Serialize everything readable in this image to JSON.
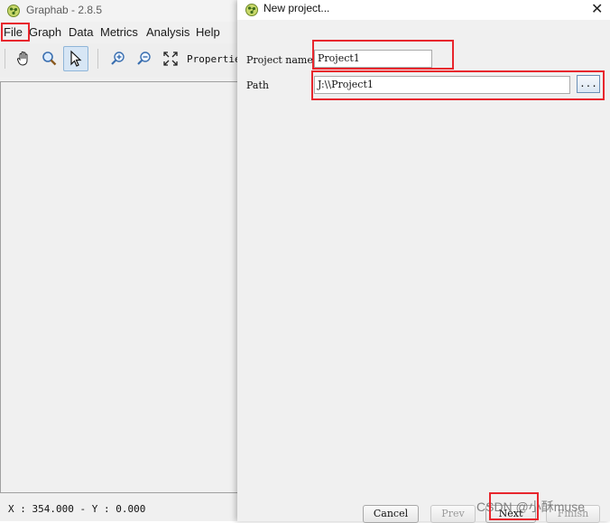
{
  "main": {
    "title": "Graphab - 2.8.5",
    "menu": [
      "File",
      "Graph",
      "Data",
      "Metrics",
      "Analysis",
      "Help"
    ],
    "toolbar": {
      "tools": [
        "hand-icon",
        "magnifier-icon",
        "pointer-icon",
        "zoom-in-icon",
        "zoom-out-icon",
        "fit-extent-icon"
      ],
      "properties_label": "Propertie"
    },
    "status": "X : 354.000 - Y : 0.000"
  },
  "dialog": {
    "title": "New project...",
    "close_glyph": "✕",
    "project_name_label": "Project name",
    "project_name_value": "Project1",
    "path_label": "Path",
    "path_value": "J:\\\\Project1",
    "browse_label": "...",
    "buttons": {
      "cancel": "Cancel",
      "prev": "Prev",
      "next": "Next",
      "finish": "Finish"
    }
  },
  "watermark": "CSDN @小酥muse",
  "colors": {
    "highlight": "#e8262d",
    "active_tool": "#d7e6f5"
  }
}
